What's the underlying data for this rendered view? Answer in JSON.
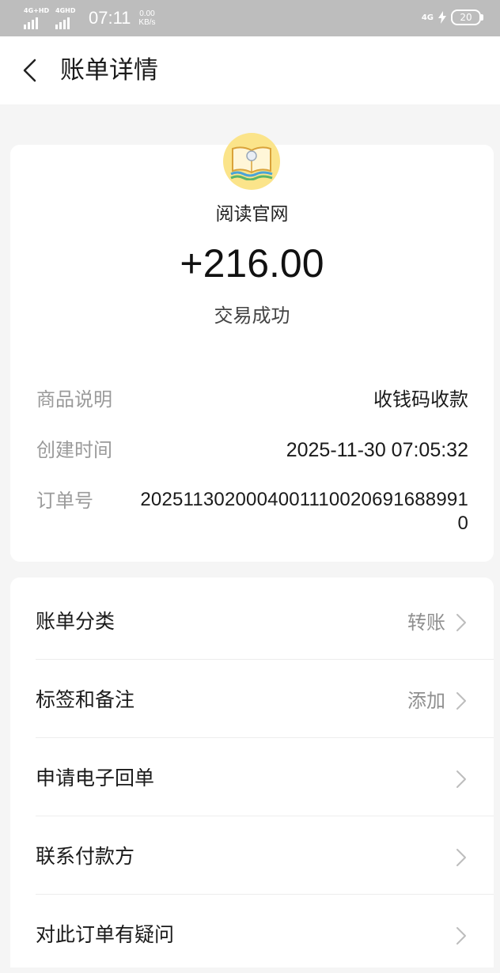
{
  "status_bar": {
    "sim1_label": "4G+HD",
    "sim2_label": "4GHD",
    "time": "07:11",
    "speed_value": "0.00",
    "speed_unit": "KB/s",
    "network": "4G",
    "battery": "20"
  },
  "header": {
    "title": "账单详情"
  },
  "transaction": {
    "merchant": "阅读官网",
    "amount": "+216.00",
    "status": "交易成功"
  },
  "details": [
    {
      "label": "商品说明",
      "value": "收钱码收款"
    },
    {
      "label": "创建时间",
      "value": "2025-11-30 07:05:32"
    },
    {
      "label": "订单号",
      "value": "20251130200040011100206916889910"
    }
  ],
  "actions": [
    {
      "label": "账单分类",
      "value": "转账"
    },
    {
      "label": "标签和备注",
      "value": "添加"
    },
    {
      "label": "申请电子回单",
      "value": ""
    },
    {
      "label": "联系付款方",
      "value": ""
    },
    {
      "label": "对此订单有疑问",
      "value": ""
    }
  ],
  "colors": {
    "status_bar_bg": "#bdbdbd",
    "page_bg": "#f5f5f5",
    "card_bg": "#ffffff",
    "logo_bg": "#fbe48a"
  }
}
